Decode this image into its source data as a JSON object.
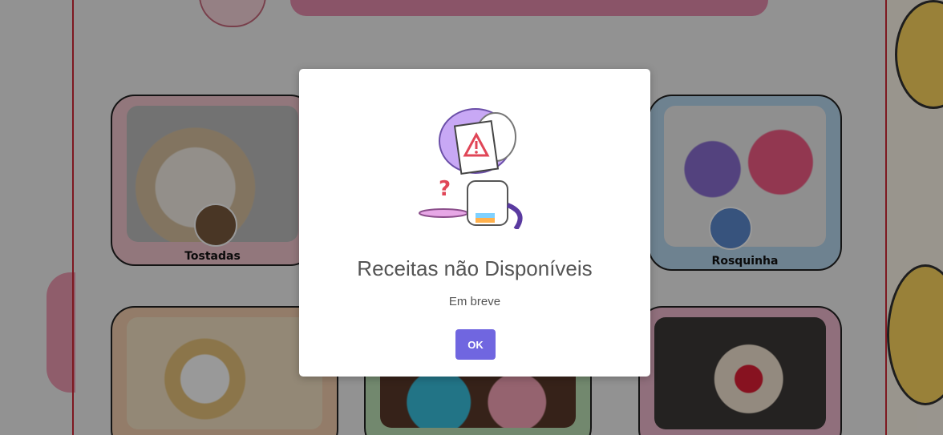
{
  "cards": [
    {
      "label": "Tostadas"
    },
    {
      "label": "Rosquinha"
    }
  ],
  "modal": {
    "title": "Receitas não Disponíveis",
    "text": "Em breve",
    "ok_label": "OK",
    "illustration": "confused-chef-with-warning-sign",
    "accent_color": "#7066e0"
  }
}
